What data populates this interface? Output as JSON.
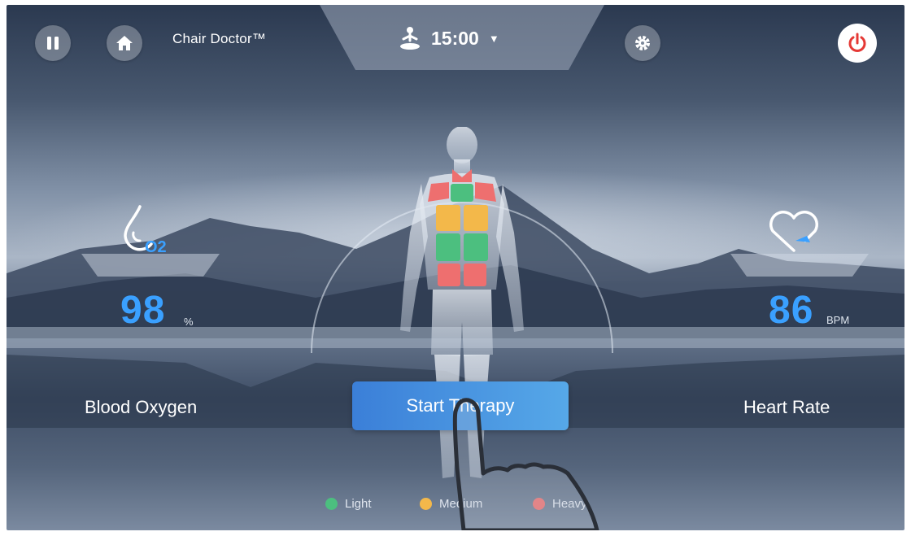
{
  "header": {
    "brand": "Chair Doctor™",
    "timer": "15:00",
    "icons": [
      "pause-icon",
      "home-icon",
      "meditation-icon",
      "chevron-down-icon",
      "gear-icon",
      "power-icon"
    ]
  },
  "metrics": {
    "oxygen": {
      "value": "98",
      "unit": "%",
      "label": "Blood Oxygen",
      "icon_text": "O2",
      "icon": "oxygen-drop-icon"
    },
    "heart": {
      "value": "86",
      "unit": "BPM",
      "label": "Heart Rate",
      "icon": "heart-icon"
    }
  },
  "action": {
    "start_label": "Start Therapy"
  },
  "legend": [
    {
      "label": "Light",
      "color": "#4cbf7f"
    },
    {
      "label": "Medium",
      "color": "#f3b84a"
    },
    {
      "label": "Heavy",
      "color": "#ee6f6f"
    }
  ],
  "colors": {
    "accent": "#3aa0ff",
    "button": "#4a93de",
    "power": "#e53935"
  }
}
